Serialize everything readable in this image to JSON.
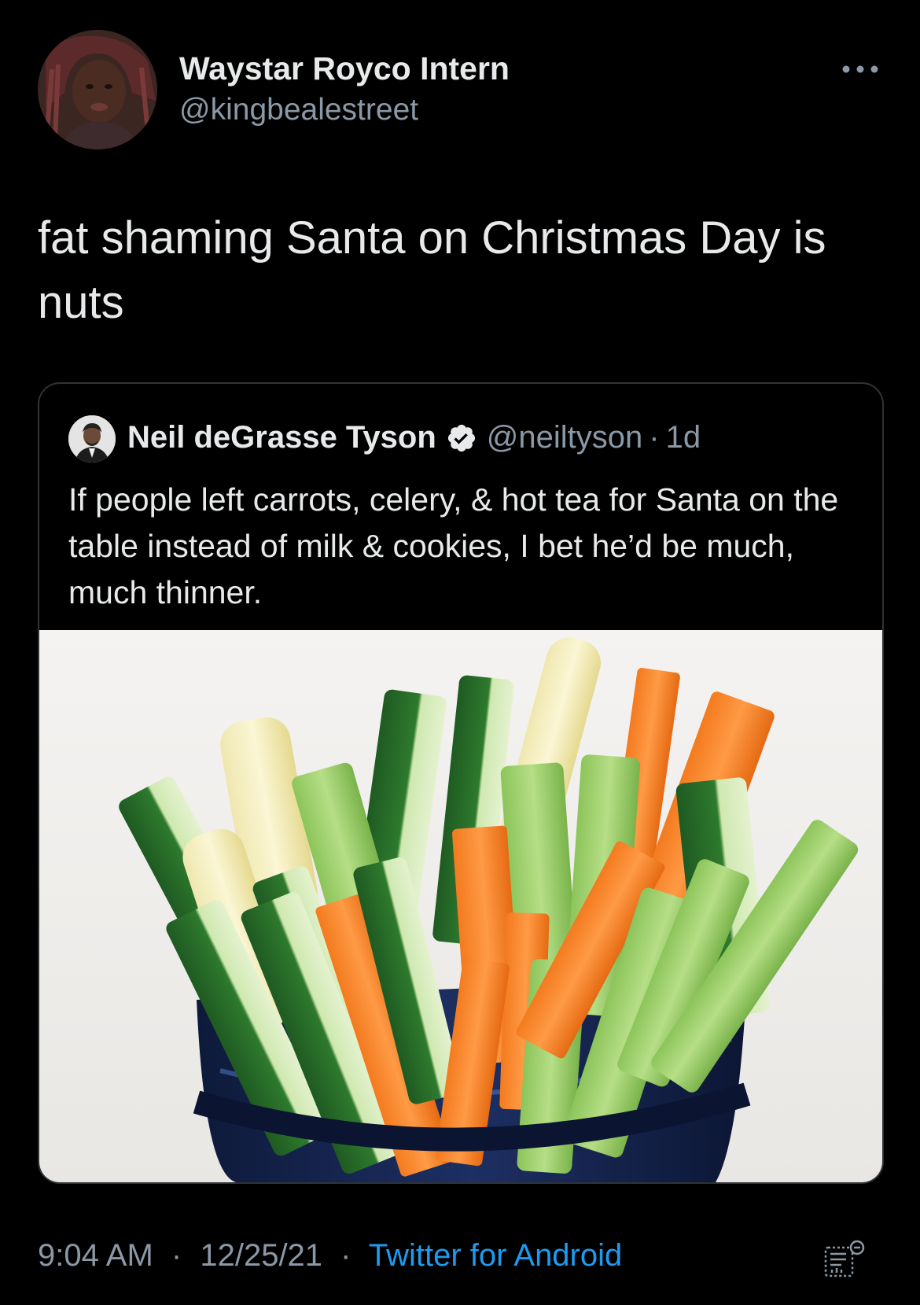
{
  "tweet": {
    "author": {
      "display_name": "Waystar Royco Intern",
      "handle": "@kingbealestreet",
      "avatar_icon": "profile-photo"
    },
    "more_icon": "more-horizontal-icon",
    "text": "fat shaming Santa on Christmas Day is nuts",
    "quoted_tweet": {
      "author": {
        "display_name": "Neil deGrasse Tyson",
        "handle": "@neiltyson",
        "verified": true,
        "avatar_icon": "profile-photo"
      },
      "separator": "·",
      "time_ago": "1d",
      "text": "If people left carrots, celery, & hot tea for Santa on the table instead of milk & cookies, I bet he’d be much, much thinner.",
      "image": "photo of cut carrot, celery, cucumber and baby corn sticks in a dark blue cup"
    },
    "meta": {
      "time": "9:04 AM",
      "date": "12/25/21",
      "separator": "·",
      "source": "Twitter for Android"
    },
    "analytics_icon": "analytics-icon"
  },
  "colors": {
    "background": "#000000",
    "text_primary": "#e7e9ea",
    "text_secondary": "#8b98a5",
    "link": "#1d9bf0",
    "border": "#2f3336",
    "verified_badge": "#e7e9ea"
  }
}
